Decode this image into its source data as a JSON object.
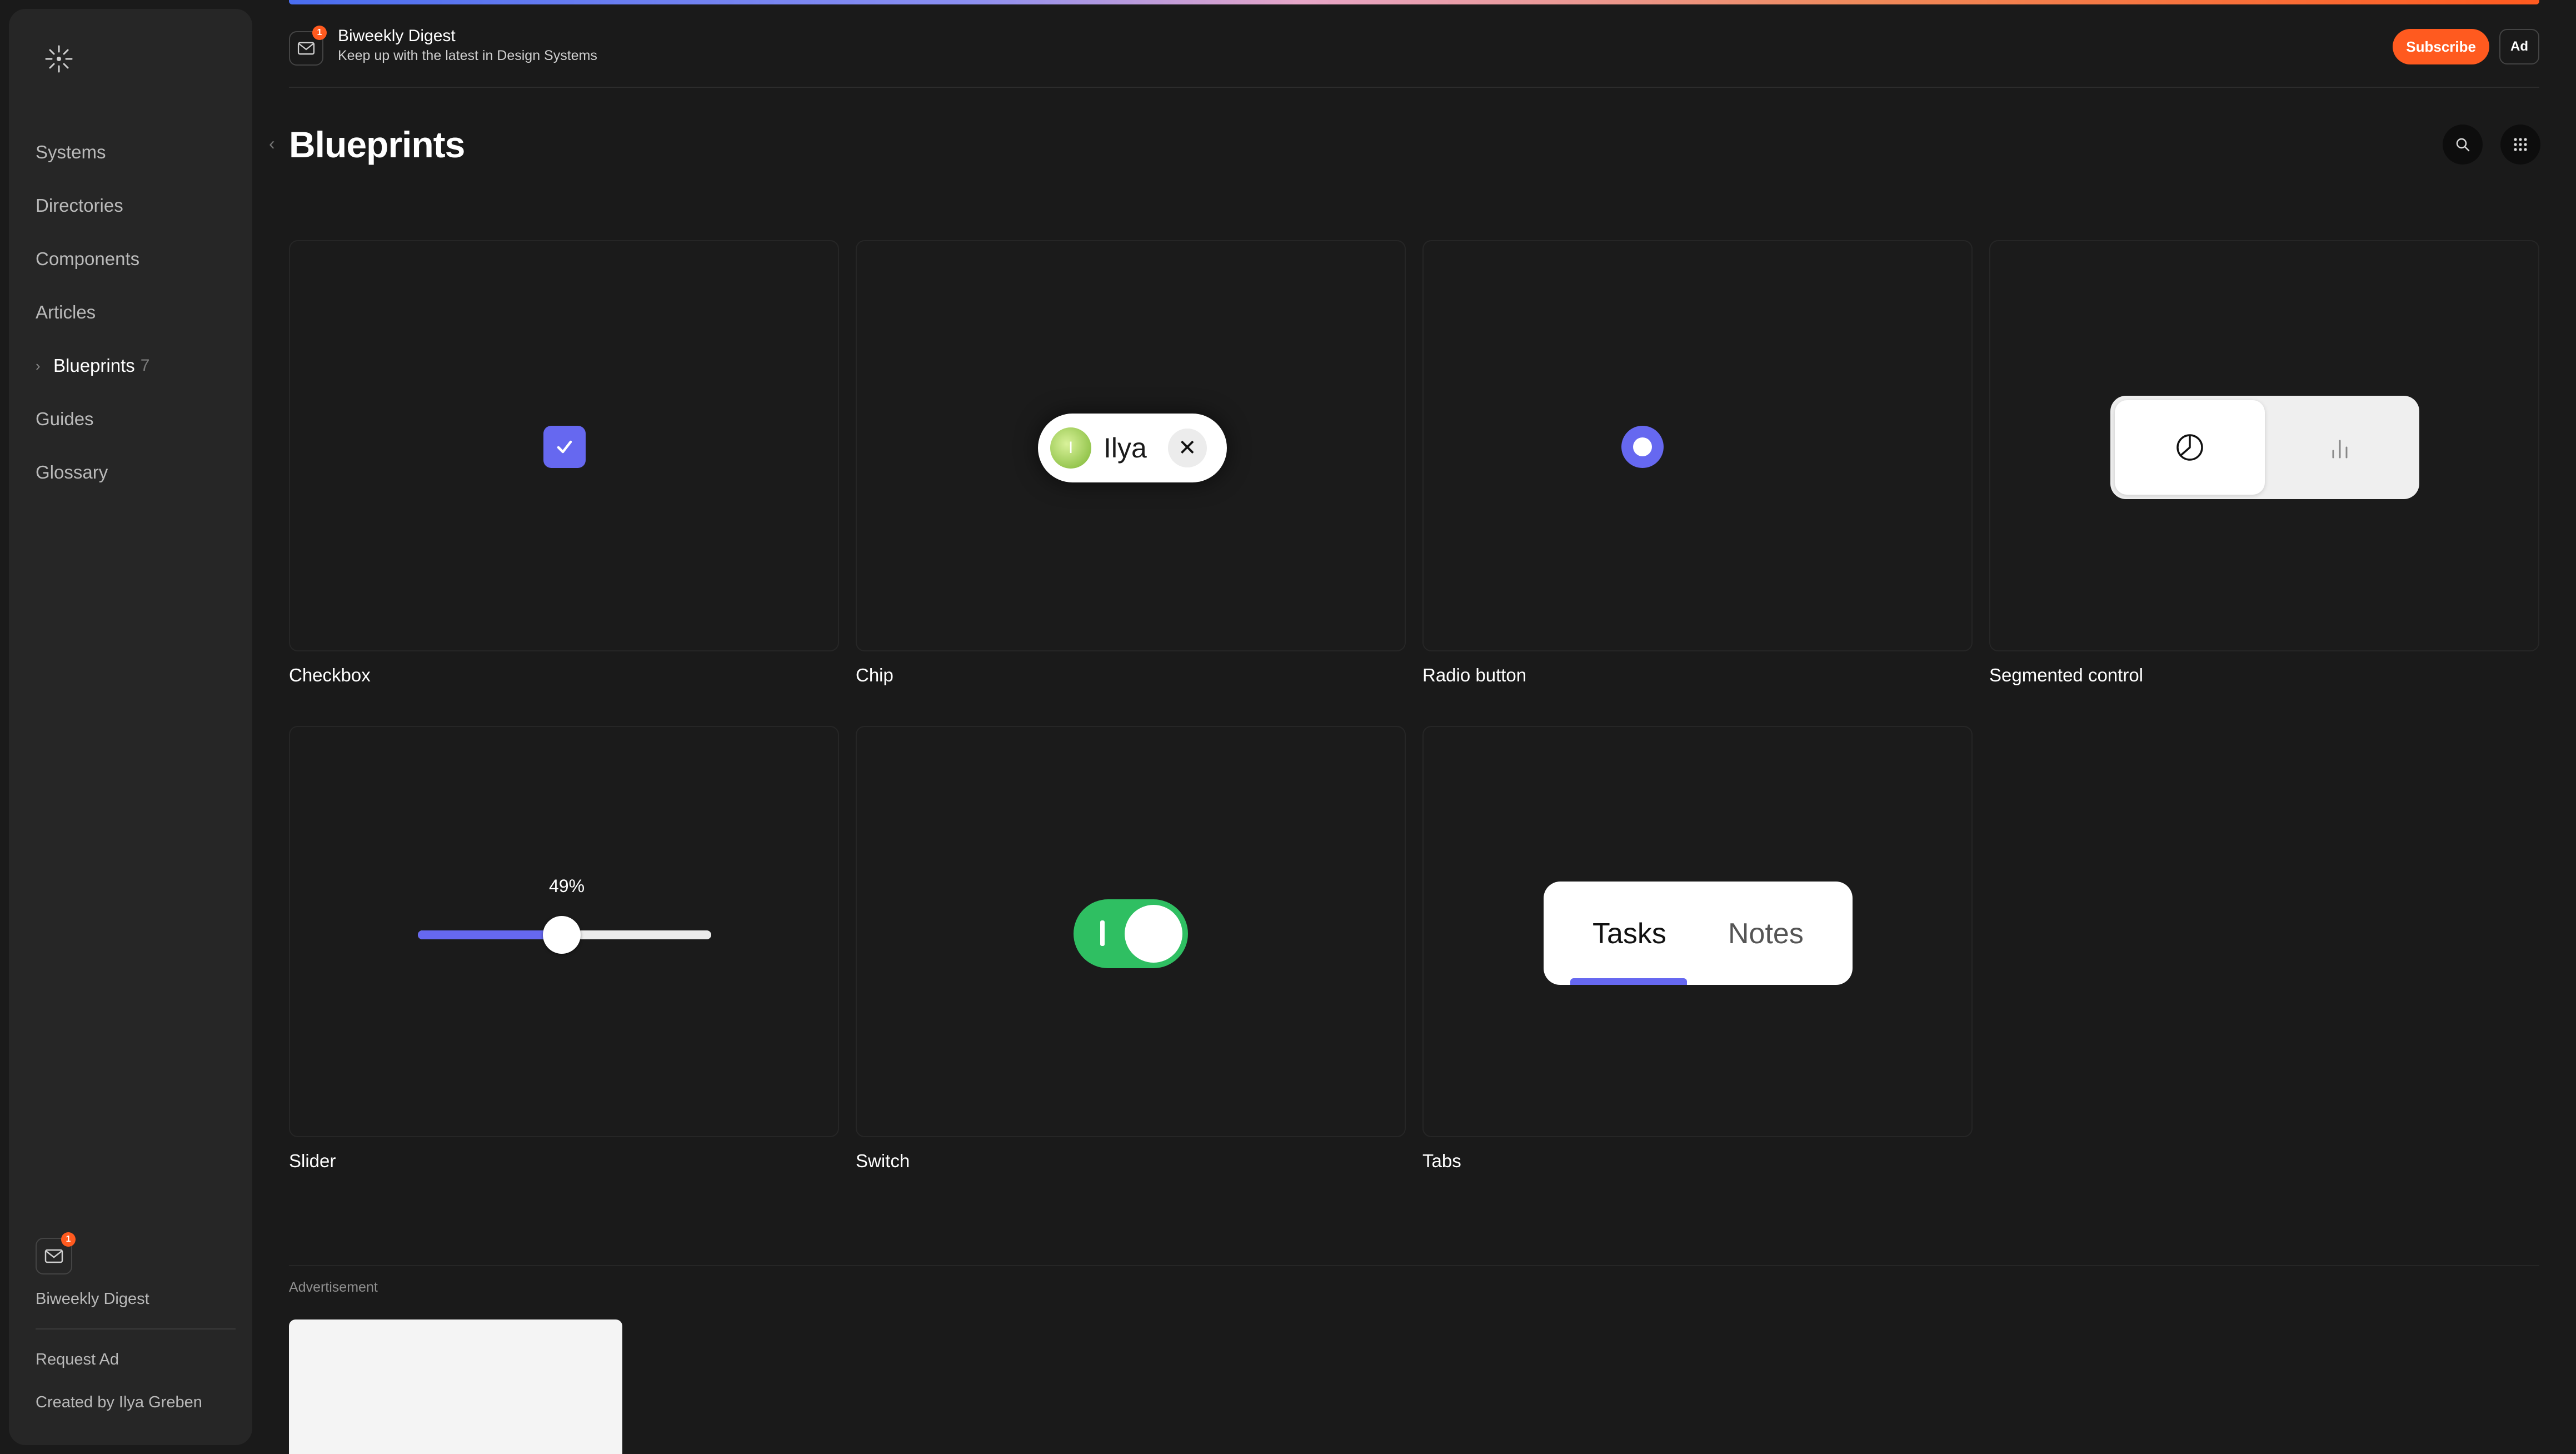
{
  "sidebar": {
    "logo": "sparkle-logo-icon",
    "items": [
      {
        "label": "Systems"
      },
      {
        "label": "Directories"
      },
      {
        "label": "Components"
      },
      {
        "label": "Articles"
      },
      {
        "label": "Blueprints",
        "count": "7"
      },
      {
        "label": "Guides"
      },
      {
        "label": "Glossary"
      }
    ],
    "digest_badge": "1",
    "digest_label": "Biweekly Digest",
    "request_ad": "Request Ad",
    "created_by": "Created by Ilya Greben"
  },
  "header": {
    "badge": "1",
    "title": "Biweekly Digest",
    "subtitle": "Keep up with the latest in Design Systems",
    "subscribe_label": "Subscribe",
    "ad_label": "Ad"
  },
  "page": {
    "title": "Blueprints"
  },
  "cards": [
    {
      "label": "Checkbox"
    },
    {
      "label": "Chip",
      "chip_text": "Ilya",
      "avatar_initial": "I"
    },
    {
      "label": "Radio button"
    },
    {
      "label": "Segmented control"
    },
    {
      "label": "Slider",
      "value_text": "49%",
      "value": 0.49
    },
    {
      "label": "Switch"
    },
    {
      "label": "Tabs",
      "tab1": "Tasks",
      "tab2": "Notes"
    }
  ],
  "advertisement": {
    "label": "Advertisement"
  },
  "colors": {
    "accent": "#6668f0",
    "brand_orange": "#ff5a1f",
    "switch_green": "#2fbf62"
  }
}
